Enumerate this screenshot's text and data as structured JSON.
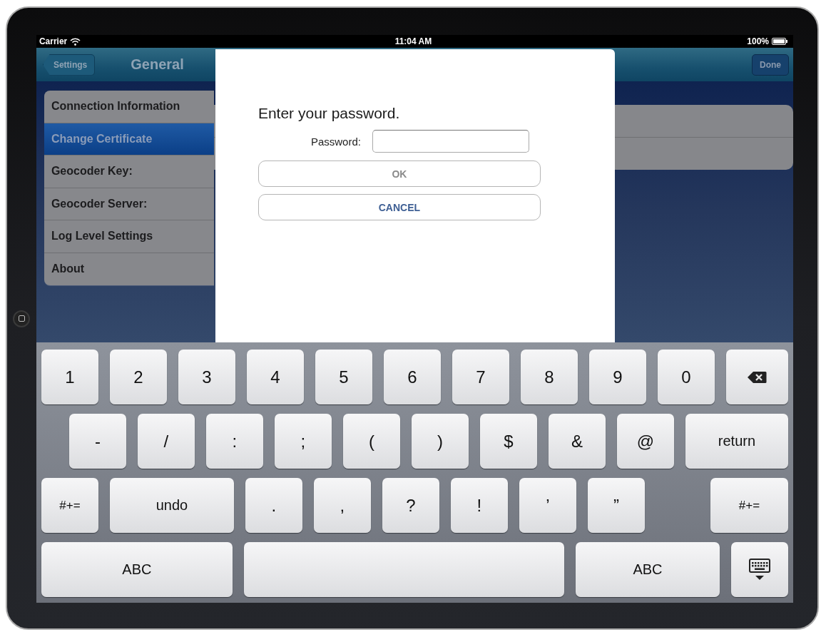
{
  "status_bar": {
    "carrier": "Carrier",
    "time": "11:04 AM",
    "battery": "100%"
  },
  "nav_bar": {
    "back_button": "Settings",
    "title": "General",
    "done_button": "Done"
  },
  "sidebar": {
    "items": [
      {
        "label": "Connection Information",
        "selected": false
      },
      {
        "label": "Change Certificate",
        "selected": true
      },
      {
        "label": "Geocoder Key:",
        "selected": false
      },
      {
        "label": "Geocoder Server:",
        "selected": false
      },
      {
        "label": "Log Level Settings",
        "selected": false
      },
      {
        "label": "About",
        "selected": false
      }
    ]
  },
  "dialog": {
    "title": "Enter your password.",
    "field_label": "Password:",
    "buttons": [
      {
        "label": "OK",
        "disabled": true
      },
      {
        "label": "CANCEL",
        "disabled": false
      }
    ]
  },
  "keyboard": {
    "rows": [
      [
        {
          "kind": "char",
          "label": "1"
        },
        {
          "kind": "char",
          "label": "2"
        },
        {
          "kind": "char",
          "label": "3"
        },
        {
          "kind": "char",
          "label": "4"
        },
        {
          "kind": "char",
          "label": "5"
        },
        {
          "kind": "char",
          "label": "6"
        },
        {
          "kind": "char",
          "label": "7"
        },
        {
          "kind": "char",
          "label": "8"
        },
        {
          "kind": "char",
          "label": "9"
        },
        {
          "kind": "char",
          "label": "0"
        },
        {
          "kind": "delete"
        }
      ],
      [
        {
          "kind": "char",
          "label": "-"
        },
        {
          "kind": "char",
          "label": "/"
        },
        {
          "kind": "char",
          "label": ":"
        },
        {
          "kind": "char",
          "label": ";"
        },
        {
          "kind": "char",
          "label": "("
        },
        {
          "kind": "char",
          "label": ")"
        },
        {
          "kind": "char",
          "label": "$"
        },
        {
          "kind": "char",
          "label": "&"
        },
        {
          "kind": "char",
          "label": "@"
        },
        {
          "kind": "return",
          "label": "return"
        }
      ],
      [
        {
          "kind": "shift",
          "label": "#+="
        },
        {
          "kind": "undo",
          "label": "undo"
        },
        {
          "kind": "char",
          "label": "."
        },
        {
          "kind": "char",
          "label": ","
        },
        {
          "kind": "char",
          "label": "?"
        },
        {
          "kind": "char",
          "label": "!"
        },
        {
          "kind": "char",
          "label": "’"
        },
        {
          "kind": "char",
          "label": "”"
        },
        {
          "kind": "shift_end",
          "label": "#+="
        }
      ],
      [
        {
          "kind": "abc_wide",
          "label": "ABC"
        },
        {
          "kind": "space"
        },
        {
          "kind": "abc",
          "label": "ABC"
        },
        {
          "kind": "hide"
        }
      ]
    ]
  }
}
